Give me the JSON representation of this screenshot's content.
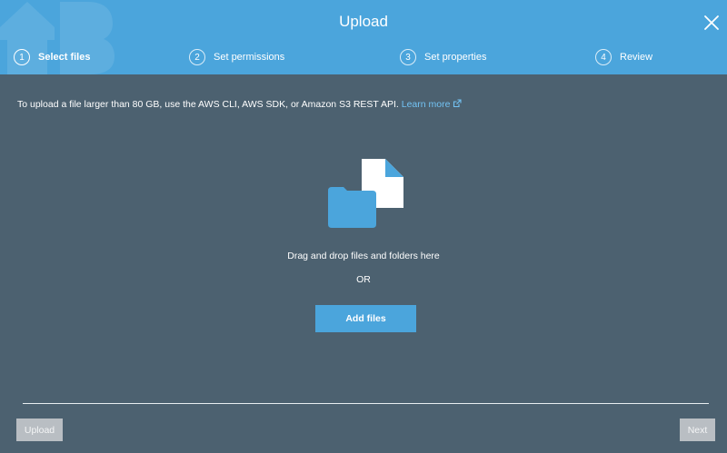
{
  "header": {
    "title": "Upload",
    "close_icon": "close-icon",
    "accent_color": "#4ba5dc"
  },
  "steps": [
    {
      "number": "1",
      "label": "Select files",
      "active": true
    },
    {
      "number": "2",
      "label": "Set permissions",
      "active": false
    },
    {
      "number": "3",
      "label": "Set properties",
      "active": false
    },
    {
      "number": "4",
      "label": "Review",
      "active": false
    }
  ],
  "notice": {
    "text": "To upload a file larger than 80 GB, use the AWS CLI, AWS SDK, or Amazon S3 REST API.",
    "link_label": "Learn more",
    "link_icon": "external-link-icon"
  },
  "dropzone": {
    "icon": "file-folder-icon",
    "text": "Drag and drop files and folders here",
    "or_text": "OR",
    "add_files_label": "Add files"
  },
  "footer": {
    "upload_label": "Upload",
    "next_label": "Next"
  },
  "colors": {
    "background": "#4c6170",
    "link": "#73c3f4",
    "disabled_button": "#b9bec3"
  }
}
